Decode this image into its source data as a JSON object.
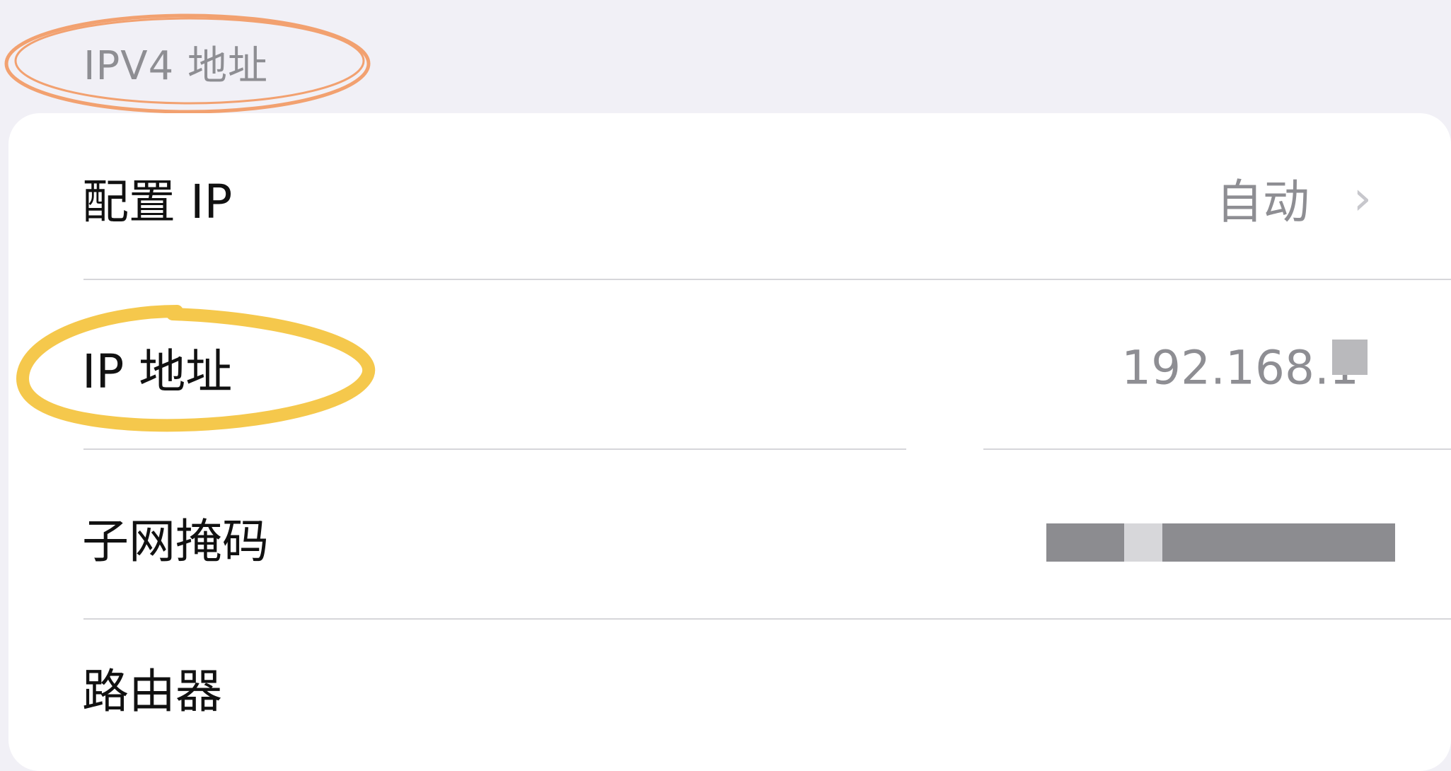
{
  "section": {
    "title": "IPV4 地址"
  },
  "rows": [
    {
      "label": "配置 IP",
      "value": "自动",
      "icon": "chevron-right-icon"
    },
    {
      "label": "IP 地址",
      "value": "192.168.1"
    },
    {
      "label": "子网掩码"
    },
    {
      "label": "路由器"
    }
  ],
  "colors": {
    "annotation_orange": "#f2a170",
    "annotation_yellow": "#f5c84c"
  }
}
